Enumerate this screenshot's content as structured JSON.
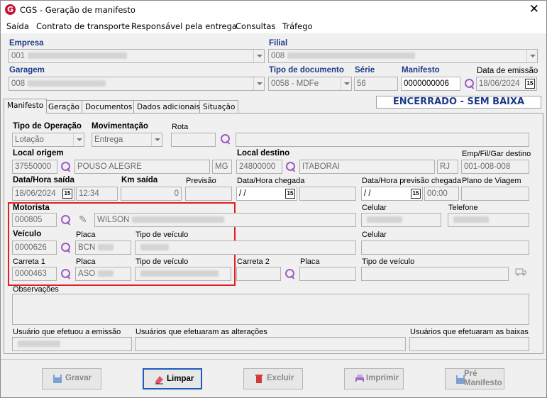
{
  "window": {
    "title": "CGS - Geração de manifesto",
    "close": "✕",
    "logo": "G"
  },
  "menu": [
    "Saída",
    "Contrato de transporte",
    "Responsável pela entrega",
    "Consultas",
    "Tráfego"
  ],
  "header": {
    "empresa_label": "Empresa",
    "empresa_value": "001",
    "filial_label": "Filial",
    "filial_value": "008",
    "garagem_label": "Garagem",
    "garagem_value": "008",
    "tipo_doc_label": "Tipo de documento",
    "tipo_doc_value": "0058 - MDFe",
    "serie_label": "Série",
    "serie_value": "56",
    "manifesto_label": "Manifesto",
    "manifesto_value": "0000000006",
    "data_emissao_label": "Data de emissão",
    "data_emissao_value": "18/06/2024",
    "status": "ENCERRADO - SEM BAIXA"
  },
  "tabs": [
    "Manifesto",
    "Geração",
    "Documentos",
    "Dados adicionais",
    "Situação"
  ],
  "form": {
    "tipo_operacao_label": "Tipo de Operação",
    "tipo_operacao_value": "Lotação",
    "movimentacao_label": "Movimentação",
    "movimentacao_value": "Entrega",
    "rota_label": "Rota",
    "local_origem_label": "Local origem",
    "local_origem_code": "37550000",
    "local_origem_city": "POUSO ALEGRE",
    "local_origem_uf": "MG",
    "local_destino_label": "Local destino",
    "local_destino_code": "24800000",
    "local_destino_city": "ITABORAI",
    "local_destino_uf": "RJ",
    "emp_fil_gar_label": "Emp/Fil/Gar destino",
    "emp_fil_gar_value": "001-008-008",
    "data_saida_label": "Data/Hora saída",
    "data_saida_date": "18/06/2024",
    "data_saida_time": "12:34",
    "km_saida_label": "Km saída",
    "km_saida_value": "0",
    "previsao_label": "Previsão",
    "data_chegada_label": "Data/Hora chegada",
    "data_chegada_value": " / /",
    "data_prev_chegada_label": "Data/Hora previsão chegada",
    "data_prev_chegada_value": " / /",
    "data_prev_chegada_time": "00:00",
    "plano_viagem_label": "Plano de Viagem",
    "motorista_label": "Motorista",
    "motorista_code": "000805",
    "motorista_name": "WILSON",
    "celular_label": "Celular",
    "telefone_label": "Telefone",
    "veiculo_label": "Veículo",
    "veiculo_code": "0000626",
    "placa_label": "Placa",
    "veiculo_placa": "BCN",
    "tipo_veiculo_label": "Tipo de veículo",
    "celular2_label": "Celular",
    "carreta1_label": "Carreta 1",
    "carreta1_code": "0000463",
    "carreta1_placa": "ASO",
    "carreta2_label": "Carreta 2",
    "observacoes_label": "Observações",
    "usuario_emissao_label": "Usuário que efetuou a emissão",
    "usuarios_alteracoes_label": "Usuários que efetuaram as alterações",
    "usuarios_baixas_label": "Usuários que efetuaram as baixas"
  },
  "buttons": {
    "gravar": "Gravar",
    "limpar": "Limpar",
    "excluir": "Excluir",
    "imprimir": "Imprimir",
    "pre_manifesto_1": "Pré",
    "pre_manifesto_2": "Manifesto"
  },
  "colors": {
    "accent": "#1f3a8a",
    "highlight": "#e02020",
    "icon": "#9b5cc4"
  }
}
